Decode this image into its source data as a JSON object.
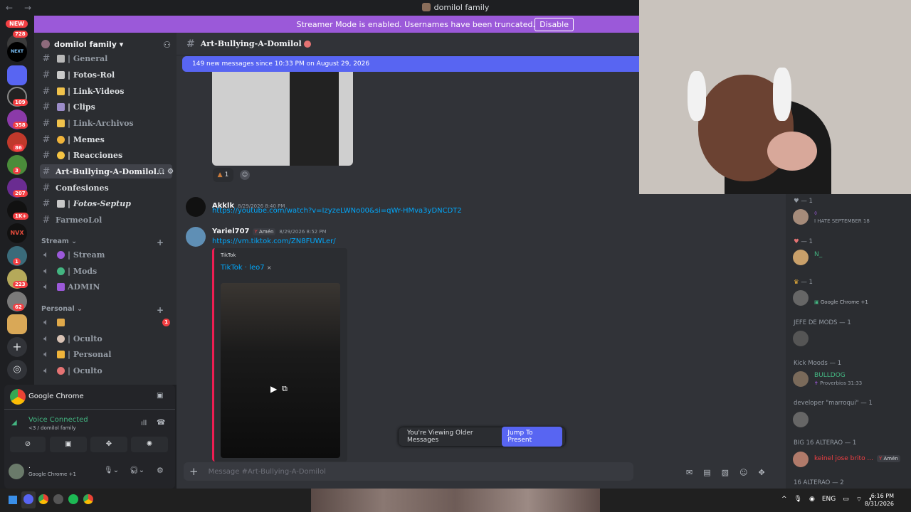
{
  "titlebar": {
    "title": "domilol family",
    "back": "←",
    "forward": "→"
  },
  "banner": {
    "text": "Streamer Mode is enabled. Usernames have been truncated.",
    "disable": "Disable"
  },
  "rail": {
    "new_badge": "NEW",
    "badges": [
      "728",
      "109",
      "358",
      "86",
      "3",
      "207",
      "1K+",
      "1",
      "223",
      "62"
    ],
    "next_label": "NEXT",
    "nvx_label": "NVX"
  },
  "server": {
    "name": "domilol family ▾"
  },
  "channels": [
    {
      "label": "| General",
      "emoji_color": "#b8b8b8"
    },
    {
      "label": "| Fotos-Rol",
      "emoji_color": "#c9c9c9"
    },
    {
      "label": "| Link-Videos",
      "emoji_color": "#f0c24b"
    },
    {
      "label": "| Clips",
      "emoji_color": "#9b8cc8"
    },
    {
      "label": "| Link-Archivos",
      "emoji_color": "#f0c24b"
    },
    {
      "label": "| Memes",
      "emoji_color": "#f0b43a"
    },
    {
      "label": "| Reacciones",
      "emoji_color": "#f5c443"
    },
    {
      "label": "Art-Bullying-A-Domilol...",
      "emoji_color": ""
    },
    {
      "label": "Confesiones",
      "emoji_color": ""
    },
    {
      "label": "| Fotos-Septup",
      "emoji_color": "#c8c8c8"
    },
    {
      "label": "FarmeoLol",
      "emoji_color": ""
    }
  ],
  "categories": {
    "stream": "Stream",
    "personal": "Personal"
  },
  "voice_channels": [
    {
      "label": "| Stream",
      "emoji_color": "#9b59d9"
    },
    {
      "label": "| Mods",
      "emoji_color": "#43b581"
    },
    {
      "label": "ADMIN",
      "emoji_color": "#9b59d9"
    },
    {
      "label": "",
      "emoji_color": "#e0a94a"
    },
    {
      "label": "| Oculto",
      "emoji_color": "#d8c2b4"
    },
    {
      "label": "| Personal",
      "emoji_color": "#f0b43a"
    },
    {
      "label": "| Oculto",
      "emoji_color": "#e57373"
    }
  ],
  "voice_badge": "1",
  "userpanel": {
    "activity": "Google Chrome",
    "voice_status": "Voice Connected",
    "voice_channel": "<3 / domilol family",
    "user_sub": "Google Chrome +1",
    "user_name": "."
  },
  "chat": {
    "channel": "Art-Bullying-A-Domilol",
    "new_messages": "149 new messages since 10:33 PM on August 29, 2026",
    "reaction_count": "1",
    "messages": [
      {
        "author": "Akklk",
        "time": "8/29/2026 8:40 PM",
        "link": "https://youtube.com/watch?v=IzyzeLWNo00&si=qWr-HMva3yDNCDT2"
      },
      {
        "author": "Yariel707",
        "role": "Amén",
        "time": "8/29/2026 8:52 PM",
        "link": "https://vm.tiktok.com/ZN8FUWLer/"
      }
    ],
    "embed": {
      "provider": "TikTok",
      "title": "TikTok · leo7",
      "close": "×"
    },
    "viewing_older": "You're Viewing Older Messages",
    "jump": "Jump To Present",
    "composer_placeholder": "Message #Art-Bullying-A-Domilol"
  },
  "members": {
    "groups": [
      {
        "header": "— 1",
        "name": "",
        "sub": "I HATE SEPTEMBER 18",
        "color": "#dbdee1"
      },
      {
        "header": "— 1",
        "name": "N_",
        "sub": "",
        "color": "#43b581"
      },
      {
        "header": "— 1",
        "name": "",
        "sub": "Google Chrome +1",
        "color": "#dbdee1"
      },
      {
        "header": "JEFE DE MODS — 1",
        "name": "",
        "sub": "",
        "color": "#dbdee1"
      },
      {
        "header": "Kick Moods — 1",
        "name": "BULLDOG",
        "sub": "Proverbios 31:33",
        "color": "#43b581"
      },
      {
        "header": "developer \"marroqui\" — 1",
        "name": "",
        "sub": "",
        "color": "#dbdee1"
      },
      {
        "header": "BIG 16 ALTERAO — 1",
        "name": "keinel jose brito ...",
        "sub": "",
        "color": "#f23f43"
      },
      {
        "header": "16 ALTERAO — 2",
        "name": "",
        "sub": "",
        "color": "#dbdee1"
      }
    ],
    "role_tag": "Amén"
  },
  "taskbar": {
    "lang": "ENG",
    "time": "6:16 PM",
    "date": "8/31/2026"
  }
}
